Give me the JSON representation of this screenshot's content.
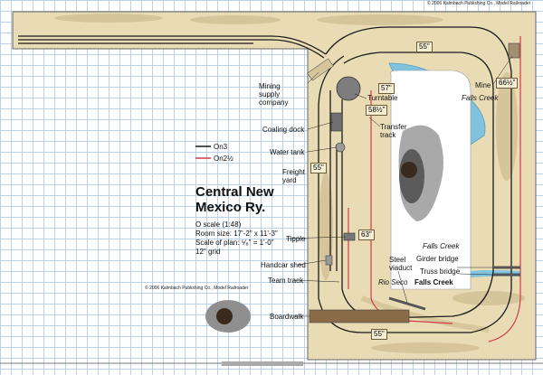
{
  "copyright_top": "© 2006 Kalmbach Publishing Co., Model Railroader",
  "copyright_mid": "© 2006 Kalmbach Publishing Co., Model Railroader",
  "title_line1": "Central New",
  "title_line2": "Mexico Ry.",
  "scale": "O scale (1:48)",
  "room_size": "Room size: 17'-2\" x 11'-3\"",
  "plan_scale": "Scale of plan: ⁵⁄₈\" = 1'-0\"",
  "grid": "12\" grid",
  "legend": {
    "on3": "On3",
    "on2half": "On2½"
  },
  "colors": {
    "on3": "#1a1a1a",
    "on2half": "#d23a4a",
    "water": "#7fc3de",
    "grid": "#b9d2ea",
    "scenery": "#e9dcb4"
  },
  "labels": {
    "mining_supply": "Mining\nsupply\ncompany",
    "turntable": "Turntable",
    "coaling_dock": "Coaling dock",
    "transfer_track": "Transfer\ntrack",
    "water_tank": "Water tank",
    "freight_yard": "Freight\nyard",
    "tipple": "Tipple",
    "handcar_shed": "Handcar shed",
    "team_track": "Team track",
    "boardwalk": "Boardwalk",
    "mine": "Mine",
    "falls_creek_top": "Falls Creek",
    "falls_creek_mid": "Falls Creek",
    "girder_bridge": "Girder bridge",
    "truss_bridge": "Truss bridge",
    "steel_viaduct": "Steel\nviaduct",
    "rio_seco": "Rio Seco",
    "falls_creek_town": "Falls Creek"
  },
  "radii": {
    "r55_top": "55\"",
    "r57": "57\"",
    "r58": "58½\"",
    "r55_left": "55\"",
    "r63": "63\"",
    "r66": "66½\"",
    "r55_bottom": "55\""
  }
}
